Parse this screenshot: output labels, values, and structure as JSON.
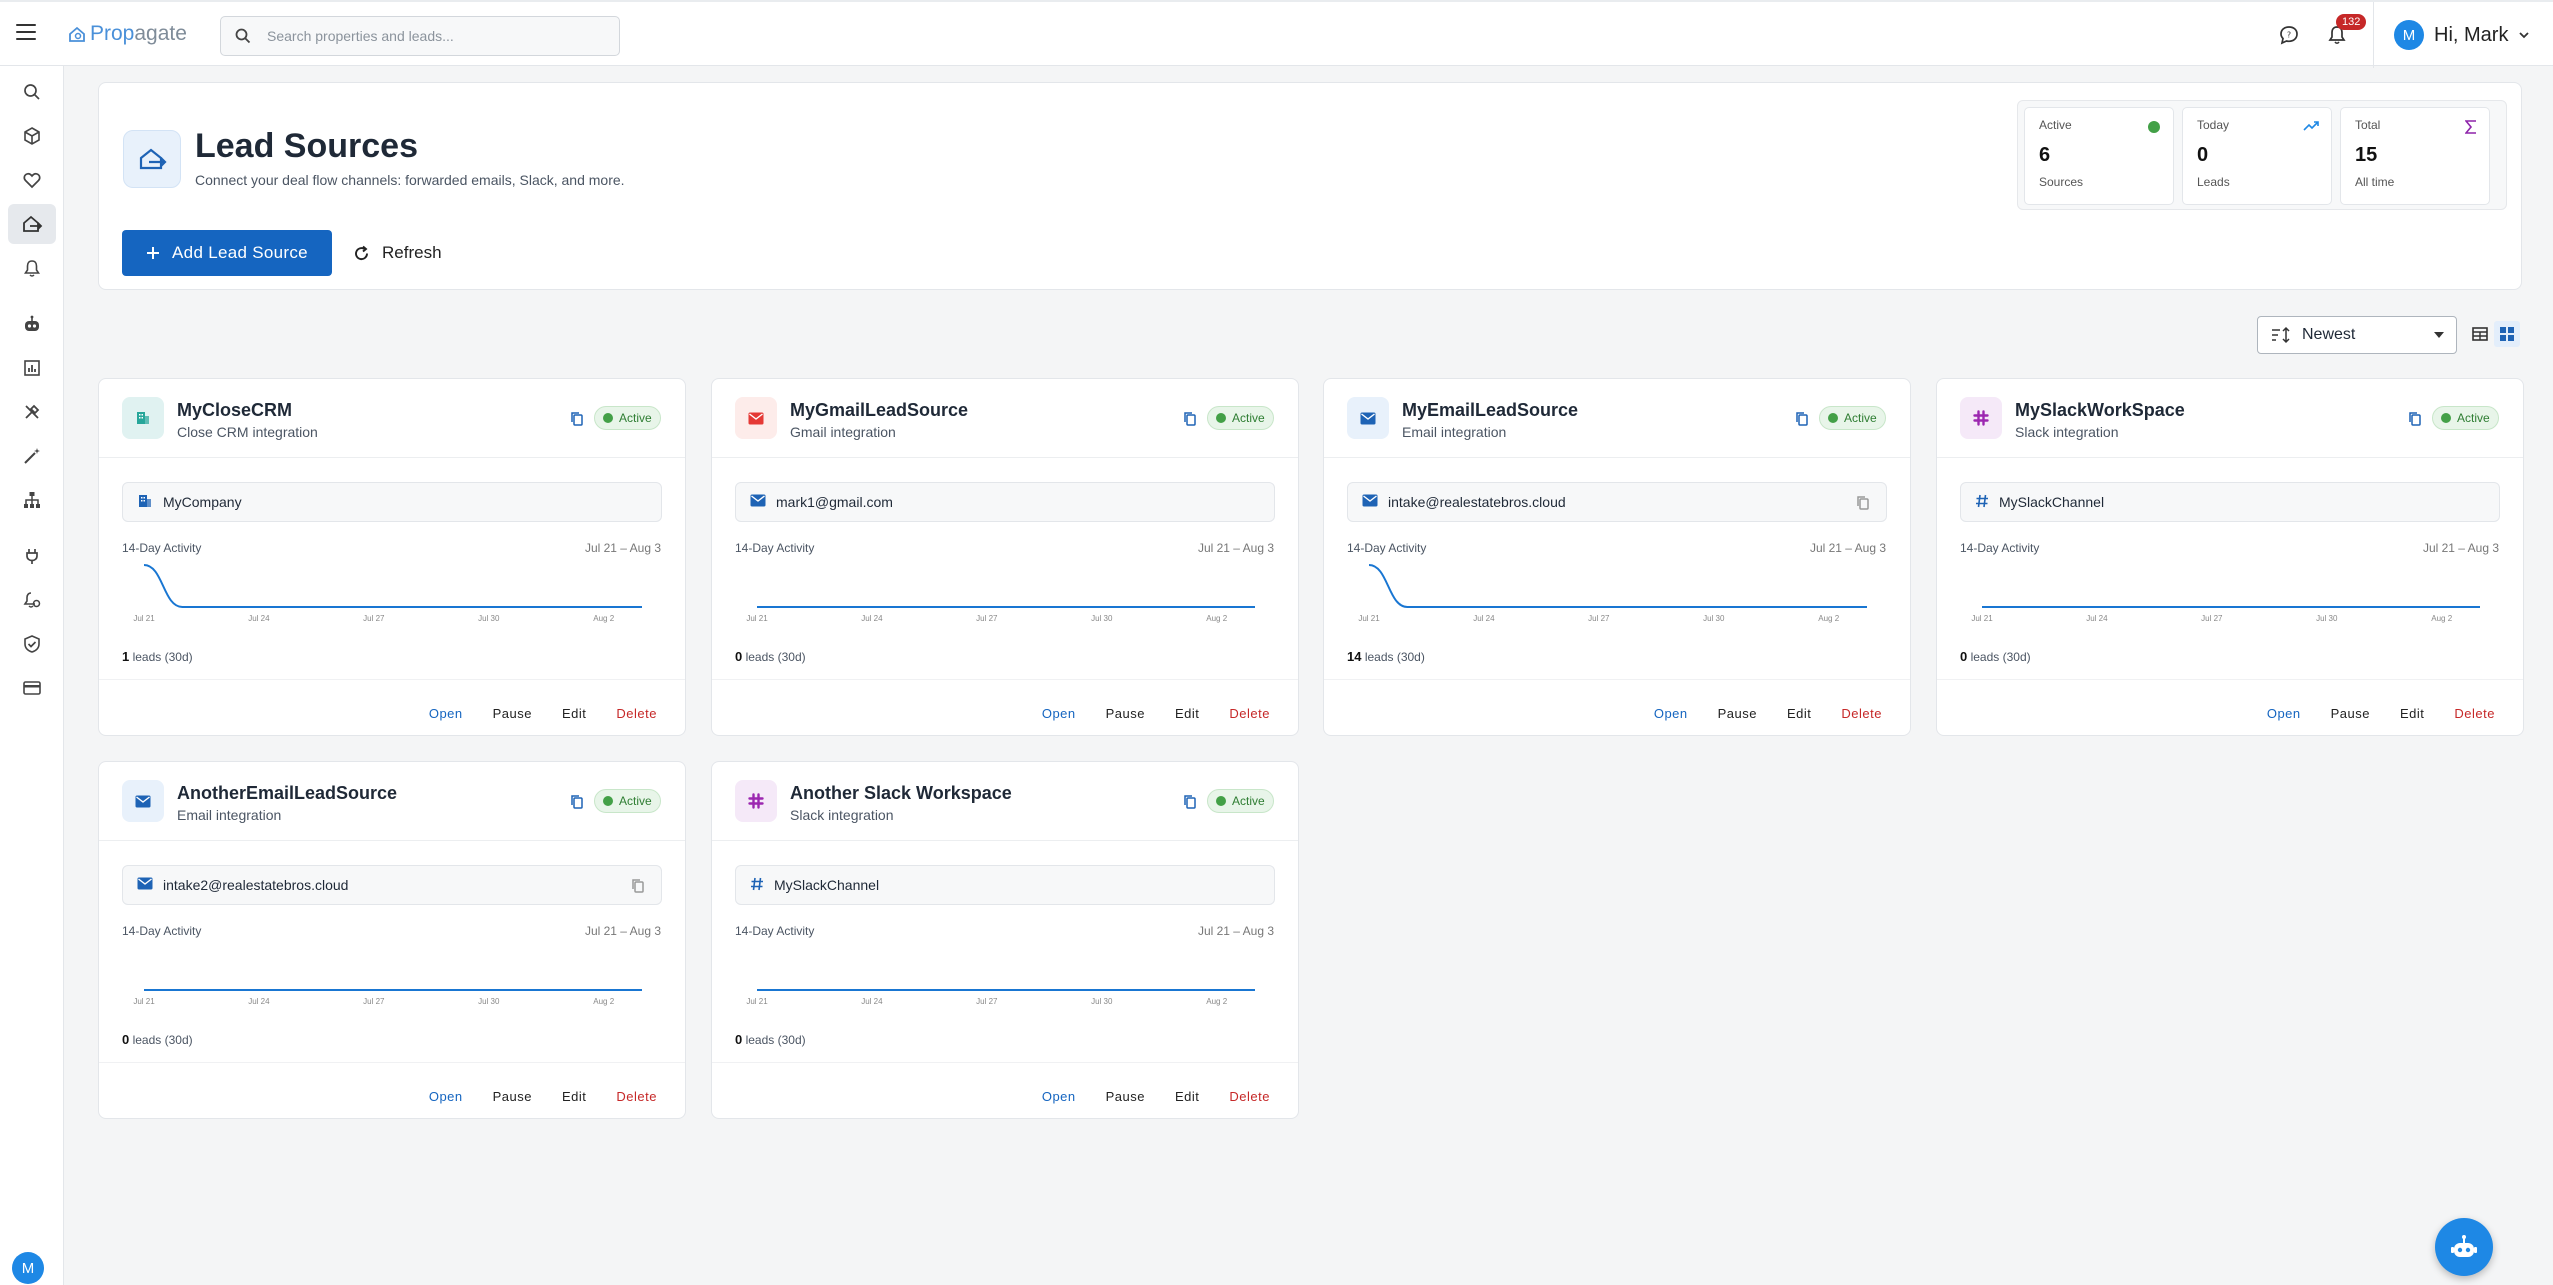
{
  "app": {
    "logo_part1": "Prop",
    "logo_part2": "agate",
    "search_placeholder": "Search properties and leads...",
    "notification_count": "132",
    "user_initial": "M",
    "greeting": "Hi, Mark"
  },
  "sidebar": {
    "items": [
      "search-icon",
      "cube-icon",
      "heart-icon",
      "lead-sources-icon",
      "bell-icon",
      "robot-icon",
      "chart-icon",
      "tools-icon",
      "magic-wand-icon",
      "sitemap-icon",
      "plug-icon",
      "bell-settings-icon",
      "shield-check-icon",
      "credit-card-icon"
    ],
    "active": "lead-sources-icon",
    "user_initial": "M"
  },
  "header": {
    "title": "Lead Sources",
    "subtitle": "Connect your deal flow channels: forwarded emails, Slack, and more.",
    "add_button": "Add Lead Source",
    "refresh_button": "Refresh"
  },
  "stats": [
    {
      "label": "Active",
      "value": "6",
      "sub": "Sources",
      "color": "#43a047"
    },
    {
      "label": "Today",
      "value": "0",
      "sub": "Leads",
      "color": "#1e88e5"
    },
    {
      "label": "Total",
      "value": "15",
      "sub": "All time",
      "color": "#8e24aa"
    }
  ],
  "toolbar": {
    "sort_value": "Newest"
  },
  "cards": [
    {
      "title": "MyCloseCRM",
      "subtitle": "Close CRM integration",
      "status": "Active",
      "icon": "building-icon",
      "icon_color": "#26a69a",
      "icon_bg": "#e0f2f1",
      "field_icon": "building-icon",
      "field_value": "MyCompany",
      "field_copy": false,
      "activity_label": "14-Day Activity",
      "activity_range": "Jul 21 – Aug 3",
      "ticks": [
        "Jul 21",
        "Jul 24",
        "Jul 27",
        "Jul 30",
        "Aug 2"
      ],
      "series": [
        1,
        0,
        0,
        0,
        0,
        0,
        0,
        0,
        0,
        0,
        0,
        0,
        0,
        0
      ],
      "leads_count": "1",
      "leads_suffix": "leads (30d)",
      "actions": {
        "open": "Open",
        "pause": "Pause",
        "edit": "Edit",
        "delete": "Delete"
      }
    },
    {
      "title": "MyGmailLeadSource",
      "subtitle": "Gmail integration",
      "status": "Active",
      "icon": "gmail-icon",
      "icon_color": "#e53935",
      "icon_bg": "#fdecea",
      "field_icon": "mail-icon",
      "field_value": "mark1@gmail.com",
      "field_copy": false,
      "activity_label": "14-Day Activity",
      "activity_range": "Jul 21 – Aug 3",
      "ticks": [
        "Jul 21",
        "Jul 24",
        "Jul 27",
        "Jul 30",
        "Aug 2"
      ],
      "series": [
        0,
        0,
        0,
        0,
        0,
        0,
        0,
        0,
        0,
        0,
        0,
        0,
        0,
        0
      ],
      "leads_count": "0",
      "leads_suffix": "leads (30d)",
      "actions": {
        "open": "Open",
        "pause": "Pause",
        "edit": "Edit",
        "delete": "Delete"
      }
    },
    {
      "title": "MyEmailLeadSource",
      "subtitle": "Email integration",
      "status": "Active",
      "icon": "mail-icon",
      "icon_color": "#1e63b5",
      "icon_bg": "#e8f1fb",
      "field_icon": "mail-icon",
      "field_value": "intake@realestatebros.cloud",
      "field_copy": true,
      "activity_label": "14-Day Activity",
      "activity_range": "Jul 21 – Aug 3",
      "ticks": [
        "Jul 21",
        "Jul 24",
        "Jul 27",
        "Jul 30",
        "Aug 2"
      ],
      "series": [
        14,
        0,
        0,
        0,
        0,
        0,
        0,
        0,
        0,
        0,
        0,
        0,
        0,
        0
      ],
      "leads_count": "14",
      "leads_suffix": "leads (30d)",
      "actions": {
        "open": "Open",
        "pause": "Pause",
        "edit": "Edit",
        "delete": "Delete"
      }
    },
    {
      "title": "MySlackWorkSpace",
      "subtitle": "Slack integration",
      "status": "Active",
      "icon": "slack-icon",
      "icon_color": "#9c27b0",
      "icon_bg": "#f5e9f8",
      "field_icon": "hash-icon",
      "field_value": "MySlackChannel",
      "field_copy": false,
      "activity_label": "14-Day Activity",
      "activity_range": "Jul 21 – Aug 3",
      "ticks": [
        "Jul 21",
        "Jul 24",
        "Jul 27",
        "Jul 30",
        "Aug 2"
      ],
      "series": [
        0,
        0,
        0,
        0,
        0,
        0,
        0,
        0,
        0,
        0,
        0,
        0,
        0,
        0
      ],
      "leads_count": "0",
      "leads_suffix": "leads (30d)",
      "actions": {
        "open": "Open",
        "pause": "Pause",
        "edit": "Edit",
        "delete": "Delete"
      }
    },
    {
      "title": "AnotherEmailLeadSource",
      "subtitle": "Email integration",
      "status": "Active",
      "icon": "mail-icon",
      "icon_color": "#1e63b5",
      "icon_bg": "#e8f1fb",
      "field_icon": "mail-icon",
      "field_value": "intake2@realestatebros.cloud",
      "field_copy": true,
      "activity_label": "14-Day Activity",
      "activity_range": "Jul 21 – Aug 3",
      "ticks": [
        "Jul 21",
        "Jul 24",
        "Jul 27",
        "Jul 30",
        "Aug 2"
      ],
      "series": [
        0,
        0,
        0,
        0,
        0,
        0,
        0,
        0,
        0,
        0,
        0,
        0,
        0,
        0
      ],
      "leads_count": "0",
      "leads_suffix": "leads (30d)",
      "actions": {
        "open": "Open",
        "pause": "Pause",
        "edit": "Edit",
        "delete": "Delete"
      }
    },
    {
      "title": "Another Slack Workspace",
      "subtitle": "Slack integration",
      "status": "Active",
      "icon": "slack-icon",
      "icon_color": "#9c27b0",
      "icon_bg": "#f5e9f8",
      "field_icon": "hash-icon",
      "field_value": "MySlackChannel",
      "field_copy": false,
      "activity_label": "14-Day Activity",
      "activity_range": "Jul 21 – Aug 3",
      "ticks": [
        "Jul 21",
        "Jul 24",
        "Jul 27",
        "Jul 30",
        "Aug 2"
      ],
      "series": [
        0,
        0,
        0,
        0,
        0,
        0,
        0,
        0,
        0,
        0,
        0,
        0,
        0,
        0
      ],
      "leads_count": "0",
      "leads_suffix": "leads (30d)",
      "actions": {
        "open": "Open",
        "pause": "Pause",
        "edit": "Edit",
        "delete": "Delete"
      }
    }
  ]
}
